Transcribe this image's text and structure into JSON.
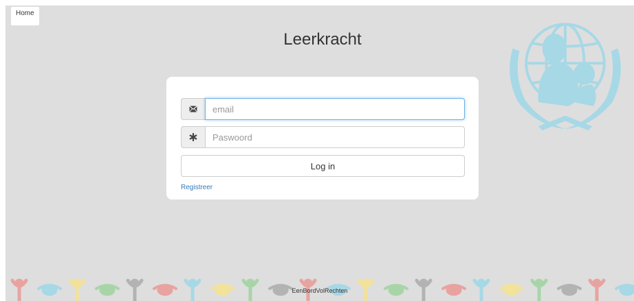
{
  "nav": {
    "home_label": "Home"
  },
  "page": {
    "title": "Leerkracht"
  },
  "form": {
    "email_placeholder": "email",
    "password_placeholder": "Paswoord",
    "login_label": "Log in",
    "register_label": "Registreer"
  },
  "footer": {
    "text": "EenBordVolRechten"
  },
  "icons": {
    "email": "envelope-icon",
    "password": "asterisk-icon",
    "logo": "unicef-emblem-icon"
  },
  "colors": {
    "background": "#dedede",
    "logo": "#a7d8e6",
    "link": "#337ab7",
    "focus": "#66afe9",
    "footer_figures": [
      "#e8a3a0",
      "#a7d8e6",
      "#f2e29a",
      "#a8d5a8",
      "#b3b3b3"
    ]
  }
}
